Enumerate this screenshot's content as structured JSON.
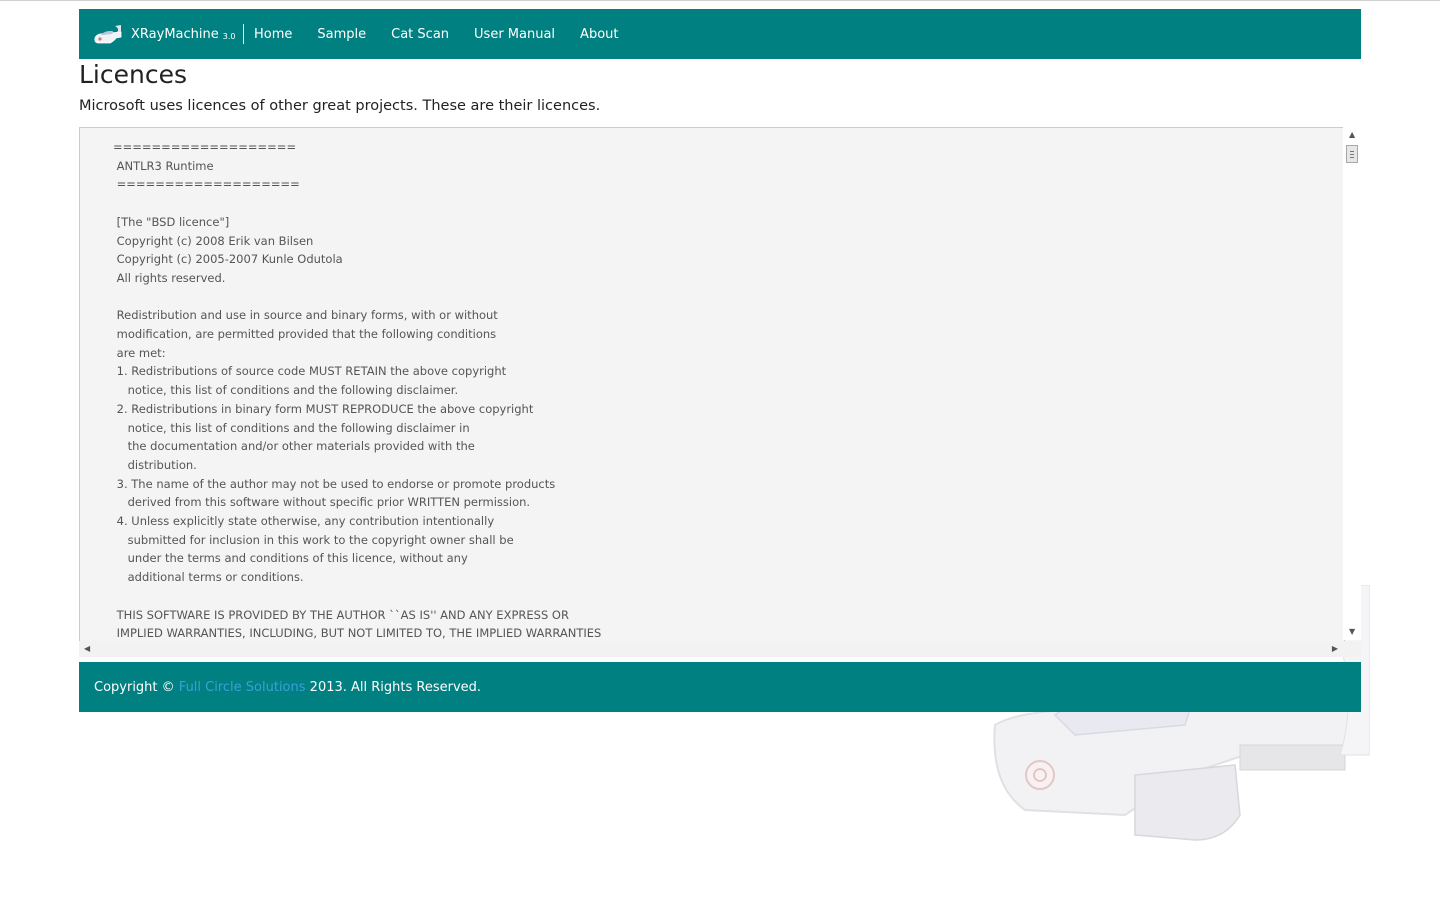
{
  "colors": {
    "accent": "#008080",
    "footer_link": "#3a9fd9",
    "licence_bg": "#f4f4f4"
  },
  "navbar": {
    "brand_name": "XRayMachine",
    "brand_version": "3.0",
    "brand_icon": "xray-machine-logo-icon",
    "links": [
      "Home",
      "Sample",
      "Cat Scan",
      "User Manual",
      "About"
    ]
  },
  "page": {
    "title": "Licences",
    "intro": "Microsoft uses licences of other great projects. These are their licences."
  },
  "licence_text": [
    "===================",
    " ANTLR3 Runtime",
    " ===================",
    "",
    " [The \"BSD licence\"]",
    " Copyright (c) 2008 Erik van Bilsen",
    " Copyright (c) 2005-2007 Kunle Odutola",
    " All rights reserved.",
    "",
    " Redistribution and use in source and binary forms, with or without",
    " modification, are permitted provided that the following conditions",
    " are met:",
    " 1. Redistributions of source code MUST RETAIN the above copyright",
    "    notice, this list of conditions and the following disclaimer.",
    " 2. Redistributions in binary form MUST REPRODUCE the above copyright",
    "    notice, this list of conditions and the following disclaimer in",
    "    the documentation and/or other materials provided with the",
    "    distribution.",
    " 3. The name of the author may not be used to endorse or promote products",
    "    derived from this software without specific prior WRITTEN permission.",
    " 4. Unless explicitly state otherwise, any contribution intentionally",
    "    submitted for inclusion in this work to the copyright owner shall be",
    "    under the terms and conditions of this licence, without any",
    "    additional terms or conditions.",
    "",
    " THIS SOFTWARE IS PROVIDED BY THE AUTHOR ``AS IS'' AND ANY EXPRESS OR",
    " IMPLIED WARRANTIES, INCLUDING, BUT NOT LIMITED TO, THE IMPLIED WARRANTIES"
  ],
  "footer": {
    "prefix": "Copyright ©",
    "link": "Full Circle Solutions",
    "suffix": "2013. All Rights Reserved."
  }
}
